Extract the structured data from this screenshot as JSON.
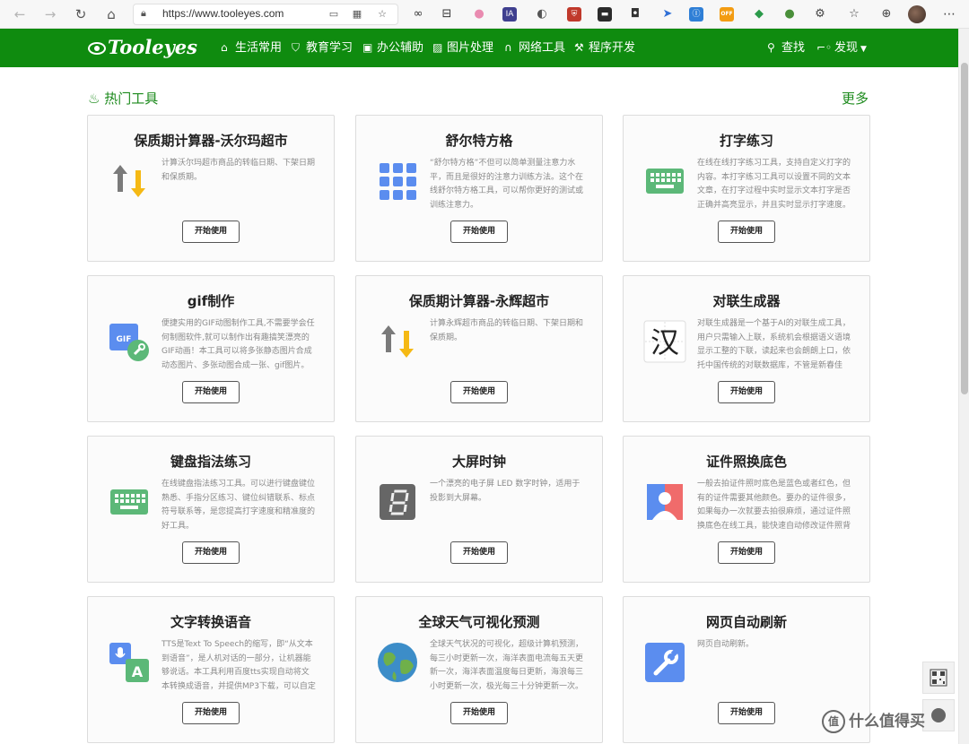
{
  "browser": {
    "url": "https://www.tooleyes.com",
    "extensions": [
      {
        "name": "infinity-icon",
        "glyph": "∞",
        "color": "#333333",
        "bg": "transparent"
      },
      {
        "name": "gift-icon",
        "glyph": "⊟",
        "color": "#333333",
        "bg": "transparent"
      },
      {
        "name": "pig-icon",
        "glyph": "●",
        "color": "#e98bb0",
        "bg": "transparent"
      },
      {
        "name": "ia-icon",
        "glyph": "IA",
        "color": "#ffffff",
        "bg": "#3f3f8f"
      },
      {
        "name": "mouse-icon",
        "glyph": "◐",
        "color": "#555555",
        "bg": "transparent"
      },
      {
        "name": "shield-badge-icon",
        "glyph": "⛨",
        "color": "#ffffff",
        "bg": "#c0392b"
      },
      {
        "name": "terminal-icon",
        "glyph": "▬",
        "color": "#ffffff",
        "bg": "#2b2b2b"
      },
      {
        "name": "camera-icon",
        "glyph": "◘",
        "color": "#333333",
        "bg": "transparent"
      },
      {
        "name": "swallow-icon",
        "glyph": "➤",
        "color": "#2f6fd6",
        "bg": "transparent"
      },
      {
        "name": "translate-icon",
        "glyph": "Ⓘ",
        "color": "#ffffff",
        "bg": "#2f7fd6"
      },
      {
        "name": "off-badge-icon",
        "glyph": "OFF",
        "color": "#ffffff",
        "bg": "#f39c12"
      },
      {
        "name": "vpn-icon",
        "glyph": "◆",
        "color": "#2b9a4a",
        "bg": "transparent"
      },
      {
        "name": "earth-icon",
        "glyph": "●",
        "color": "#4a8f3a",
        "bg": "transparent"
      },
      {
        "name": "puzzle-icon",
        "glyph": "⚙",
        "color": "#444444",
        "bg": "transparent"
      },
      {
        "name": "favorites-icon",
        "glyph": "☆",
        "color": "#444444",
        "bg": "transparent"
      },
      {
        "name": "collections-icon",
        "glyph": "⊕",
        "color": "#444444",
        "bg": "transparent"
      }
    ]
  },
  "site": {
    "logo": "Tooleyes",
    "nav": [
      {
        "name": "nav-daily",
        "icon": "⌂",
        "label": "生活常用"
      },
      {
        "name": "nav-education",
        "icon": "⛉",
        "label": "教育学习"
      },
      {
        "name": "nav-office",
        "icon": "▣",
        "label": "办公辅助"
      },
      {
        "name": "nav-image",
        "icon": "▨",
        "label": "图片处理"
      },
      {
        "name": "nav-network",
        "icon": "∩",
        "label": "网络工具"
      },
      {
        "name": "nav-dev",
        "icon": "⚒",
        "label": "程序开发"
      }
    ],
    "search_label": "查找",
    "discover_label": "发现"
  },
  "section": {
    "title": "热门工具",
    "more": "更多"
  },
  "button_label": "开始使用",
  "cards": [
    {
      "title": "保质期计算器-沃尔玛超市",
      "icon": "arrows",
      "desc": "计算沃尔玛超市商品的转临日期、下架日期和保质期。"
    },
    {
      "title": "舒尔特方格",
      "icon": "grid",
      "desc": "“舒尔特方格”不但可以简单测量注意力水平，而且是很好的注意力训练方法。这个在线舒尔特方格工具，可以帮你更好的测试或训练注意力。"
    },
    {
      "title": "打字练习",
      "icon": "keyboard",
      "desc": "在线在线打字练习工具，支持自定义打字的内容。本打字练习工具可以设置不同的文本文章，在打字过程中实时显示文本打字是否正确并高亮显示，并且实时显示打字速度。"
    },
    {
      "title": "gif制作",
      "icon": "gif",
      "desc": "便捷实用的GIF动图制作工具,不需要学会任何制图软件,就可以制作出有趣搞笑漂亮的GIF动画！本工具可以将多张静态图片合成动态图片、多张动图合成一张、gif图片。"
    },
    {
      "title": "保质期计算器-永辉超市",
      "icon": "arrows",
      "desc": "计算永辉超市商品的转临日期、下架日期和保质期。"
    },
    {
      "title": "对联生成器",
      "icon": "han",
      "desc": "对联生成器是一个基于AI的对联生成工具，用户只需输入上联，系统机会根据语义语境显示工整的下联，读起来也会朗朗上口，依托中国传统的对联数据库，不管是新春佳节。"
    },
    {
      "title": "键盘指法练习",
      "icon": "keyboard",
      "desc": "在线键盘指法练习工具。可以进行键盘键位熟悉、手指分区练习、键位纠错联系、标点符号联系等，是您提高打字速度和精准度的好工具。"
    },
    {
      "title": "大屏时钟",
      "icon": "led",
      "desc": "一个漂亮的电子屏 LED 数字时钟，适用于投影到大屏幕。"
    },
    {
      "title": "证件照换底色",
      "icon": "idphoto",
      "desc": "一般去拍证件照时底色是蓝色或者红色，但有的证件需要其他颜色。要办的证件很多，如果每办一次就要去拍很麻烦，通过证件照换底色在线工具，能快速自动修改证件照背景色。"
    },
    {
      "title": "文字转换语音",
      "icon": "tts",
      "desc": "TTS是Text To Speech的缩写，即“从文本到语音”，是人机对话的一部分，让机器能够说话。本工具利用百度tts实现自动将文本转换成语音，并提供MP3下载，可以自定义语速。"
    },
    {
      "title": "全球天气可视化预测",
      "icon": "globe",
      "desc": "全球天气状况的可视化，超级计算机预测，每三小时更新一次，海洋表面电流每五天更新一次，海洋表面温度每日更新，海浪每三小时更新一次，极光每三十分钟更新一次。"
    },
    {
      "title": "网页自动刷新",
      "icon": "wrench",
      "desc": "网页自动刷新。"
    }
  ],
  "watermark": "什么值得买",
  "colors": {
    "brand_green": "#0f8b0f",
    "section_green": "#1c8a1c",
    "icon_blue": "#5b8def",
    "icon_green": "#5cb878",
    "arrow_yellow": "#f5b914",
    "arrow_gray": "#7a7a7a"
  }
}
